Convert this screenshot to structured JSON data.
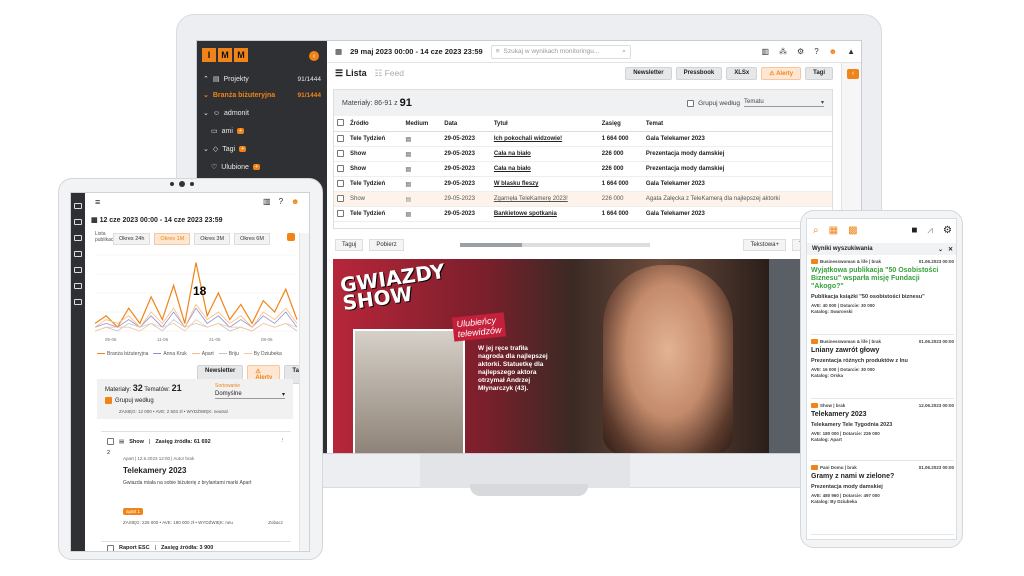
{
  "desktop": {
    "logo": [
      "I",
      "M",
      "M"
    ],
    "date_range": "29 maj 2023 00:00 - 14 cze 2023 23:59",
    "search_placeholder": "Szukaj w wynikach monitoringu...",
    "sidebar": [
      {
        "label": "Projekty",
        "count": "91/1444",
        "active": false
      },
      {
        "label": "Branża biżuteryjna",
        "count": "91/1444",
        "active": true
      },
      {
        "label": "admonit",
        "count": "",
        "active": false
      },
      {
        "label": "ami",
        "count": "",
        "active": false
      },
      {
        "label": "Tagi",
        "count": "",
        "active": false
      },
      {
        "label": "Ulubione",
        "count": "",
        "active": false
      }
    ],
    "tabs": {
      "lista": "Lista",
      "feed": "Feed"
    },
    "toolbar_buttons": [
      "Newsletter",
      "Pressbook",
      "XLSx",
      "Alerty",
      "Tagi"
    ],
    "materials_label": "Materiały: 86-91 z",
    "materials_total": "91",
    "group_label": "Grupuj według",
    "group_value": "Tematu",
    "columns": [
      "Źródło",
      "Medium",
      "Data",
      "Tytuł",
      "Zasięg",
      "Temat"
    ],
    "rows": [
      {
        "src": "Tele Tydzień",
        "date": "29-05-2023",
        "title": "Ich pokochali widzowie!",
        "reach": "1 664 000",
        "topic": "Gala Telekamer 2023",
        "read": false
      },
      {
        "src": "Show",
        "date": "29-05-2023",
        "title": "Cała na biało",
        "reach": "226 000",
        "topic": "Prezentacja mody damskiej",
        "read": false
      },
      {
        "src": "Show",
        "date": "29-05-2023",
        "title": "Cała na biało",
        "reach": "226 000",
        "topic": "Prezentacja mody damskiej",
        "read": false
      },
      {
        "src": "Tele Tydzień",
        "date": "29-05-2023",
        "title": "W blasku fleszy",
        "reach": "1 664 000",
        "topic": "Gala Telekamer 2023",
        "read": false
      },
      {
        "src": "Show",
        "date": "29-05-2023",
        "title": "Zgarnęła TeleKamerę 2023!",
        "reach": "226 000",
        "topic": "Agata Załęcka z TeleKamerą dla najlepszej aktorki",
        "read": true
      },
      {
        "src": "Tele Tydzień",
        "date": "29-05-2023",
        "title": "Bankietowe spotkania",
        "reach": "1 664 000",
        "topic": "Gala Telekamer 2023",
        "read": false
      }
    ],
    "preview_buttons": {
      "tag": "Taguj",
      "download": "Pobierz",
      "text_plus": "Tekstowa+",
      "text": "Tekstowa"
    },
    "preview_progress": 0.33,
    "magazine": {
      "title_line1": "GWIAZDY",
      "title_line2": "SHOW",
      "subtitle_line1": "Ulubieńcy",
      "subtitle_line2": "telewidzów",
      "body": "W jej ręce trafiła nagroda dla najlepszej aktorki. Statuetkę dla najlepszego aktora otrzymał Andrzej Młynarczyk (43)."
    }
  },
  "tablet": {
    "date_range": "12 cze 2023 00:00 - 14 cze 2023 23:59",
    "list_label": "Lista publikacji",
    "periods": [
      "Okres 24h",
      "Okres 1M",
      "Okres 3M",
      "Okres 6M"
    ],
    "active_period": "Okres 1M",
    "chart_data": {
      "type": "line",
      "title": "",
      "annotation": "18",
      "x": [
        "05-06",
        "11-06",
        "21-05",
        "08-06"
      ],
      "series": [
        {
          "name": "Branża biżuteryjna",
          "color": "#f08418",
          "values": [
            2,
            4,
            1,
            6,
            2,
            9,
            3,
            12,
            2,
            18,
            4,
            10,
            3,
            7,
            2,
            8,
            5,
            11,
            3
          ]
        },
        {
          "name": "Anna Kruk",
          "color": "#8c8fd6",
          "values": [
            1,
            2,
            1,
            3,
            1,
            4,
            1,
            5,
            1,
            6,
            2,
            4,
            1,
            3,
            1,
            4,
            2,
            5,
            1
          ]
        },
        {
          "name": "Apart",
          "color": "#ffb97a",
          "values": [
            1,
            3,
            2,
            4,
            1,
            5,
            2,
            6,
            1,
            7,
            3,
            5,
            2,
            4,
            1,
            5,
            3,
            6,
            2
          ]
        },
        {
          "name": "Briju",
          "color": "#c4c4c4",
          "values": [
            0,
            1,
            0,
            2,
            1,
            2,
            0,
            3,
            1,
            2,
            1,
            2,
            0,
            1,
            0,
            2,
            1,
            2,
            0
          ]
        },
        {
          "name": "By Dziubeka",
          "color": "#f5c6a0",
          "values": [
            0,
            1,
            1,
            1,
            0,
            2,
            1,
            2,
            0,
            3,
            1,
            2,
            1,
            1,
            0,
            2,
            1,
            2,
            1
          ]
        }
      ]
    },
    "buttons": [
      "Newsletter",
      "Alerty",
      "Tagi"
    ],
    "materials_label": "Materiały:",
    "materials": "32",
    "topics_label": "Tematów:",
    "topics": "21",
    "group_label": "Grupuj według",
    "sort_label": "Sortowanie",
    "sort_value": "Domyślne",
    "stats_line": "ZASIĘG: 12 000 • AVE: 2 503 zł • WYDŹWIĘK: neutral",
    "card": {
      "source": "Show",
      "source_extra": "Zasięg źródła: 61 692",
      "num": "2",
      "meta": "Apart | 12.6.2023 12:00 | Autor brak",
      "title": "Telekamery 2023",
      "text": "Gwiazda miała na sobie biżuterię z brylantami marki Apart",
      "tag": "apart 1",
      "stats": "ZASIĘG: 226 000 • AVE: 180 000 zł • WYDŹWIĘK: neu",
      "link": "Zobacz"
    },
    "card2": {
      "source": "Raport ESC",
      "source_extra": "Zasięg źródła: 3 900"
    }
  },
  "phone": {
    "results_title": "Wyniki wyszukiwania",
    "cards": [
      {
        "source": "Businesswoman & life | brak",
        "date": "01.06.2023 00:00",
        "title": "Wyjątkowa publikacja \"50 Osobistości Biznesu\" wsparła misję Fundacji \"Akogo?\"",
        "green": true,
        "subtitle": "Publikacja książki \"50 osobistości biznesu\"",
        "meta1": "AVE: 40 000 | Dotarcie: 30 000",
        "meta2": "Katalog: Swarovski"
      },
      {
        "source": "Businesswoman & life | brak",
        "date": "01.06.2023 00:00",
        "title": "Lniany zawrót głowy",
        "green": false,
        "subtitle": "Prezentacja różnych produktów z lnu",
        "meta1": "AVE: 16 000 | Dotarcie: 30 000",
        "meta2": "Katalog: Orska"
      },
      {
        "source": "Show | brak",
        "date": "12.06.2023 00:00",
        "title": "Telekamery 2023",
        "green": false,
        "subtitle": "Telekamery Tele Tygodnia 2023",
        "meta1": "AVE: 180 000 | Dotarcie: 226 000",
        "meta2": "Katalog: Apart"
      },
      {
        "source": "Pani Domu | brak",
        "date": "01.06.2023 00:00",
        "title": "Gramy z nami w zielone?",
        "green": false,
        "subtitle": "Prezentacja mody damskiej",
        "meta1": "AVE: 480 960 | Dotarcie: 497 000",
        "meta2": "Katalog: By Dziubeka"
      }
    ]
  },
  "colors": {
    "accent": "#f08418",
    "sidebar": "#2f3033",
    "green": "#37a03d"
  }
}
